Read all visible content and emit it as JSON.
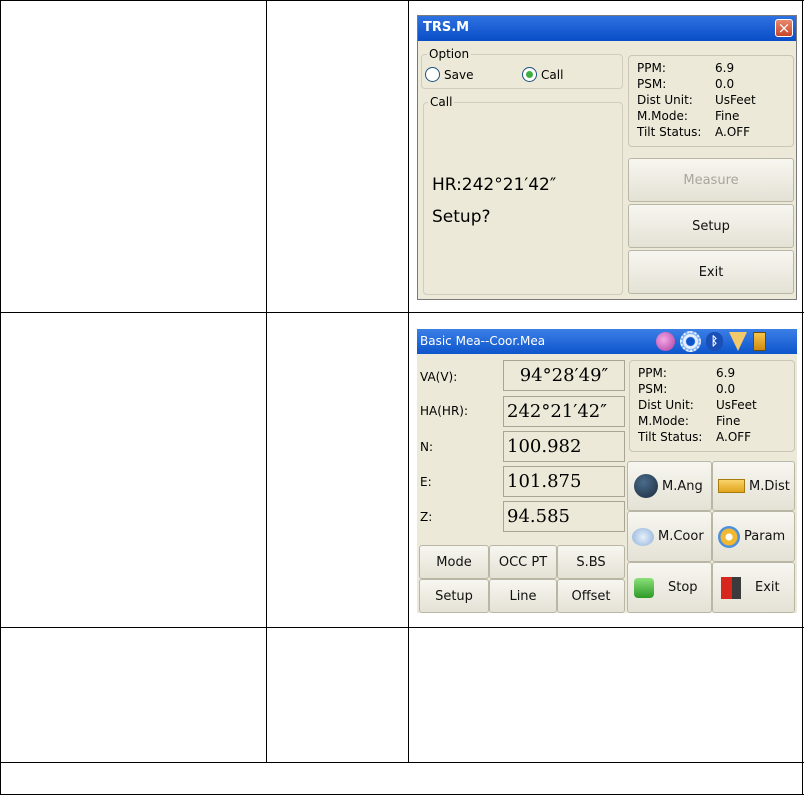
{
  "dialog1": {
    "title": "TRS.M",
    "close_label": "×",
    "option_legend": "Option",
    "save_label": "Save",
    "call_label": "Call",
    "selected_option": "Call",
    "call_legend": "Call",
    "hr_text": "HR:242°21′42″",
    "setup_question": "Setup?",
    "status": [
      {
        "key": "PPM:",
        "value": "6.9"
      },
      {
        "key": "PSM:",
        "value": "0.0"
      },
      {
        "key": "Dist Unit:",
        "value": "UsFeet"
      },
      {
        "key": "M.Mode:",
        "value": "Fine"
      },
      {
        "key": "Tilt Status:",
        "value": "A.OFF"
      }
    ],
    "buttons": {
      "measure": "Measure",
      "setup": "Setup",
      "exit": "Exit"
    }
  },
  "dialog2": {
    "title": "Basic Mea--Coor.Mea",
    "status_icons": [
      "timer-icon",
      "gear-icon",
      "bluetooth-icon",
      "signal-icon",
      "battery-icon"
    ],
    "fields": [
      {
        "label": "VA(V):",
        "value": "94°28′49″"
      },
      {
        "label": "HA(HR):",
        "value": "242°21′42″"
      },
      {
        "label": "N:",
        "value": "100.982"
      },
      {
        "label": "E:",
        "value": "101.875"
      },
      {
        "label": "Z:",
        "value": "94.585"
      }
    ],
    "status": [
      {
        "key": "PPM:",
        "value": "6.9"
      },
      {
        "key": "PSM:",
        "value": "0.0"
      },
      {
        "key": "Dist Unit:",
        "value": "UsFeet"
      },
      {
        "key": "M.Mode:",
        "value": "Fine"
      },
      {
        "key": "Tilt Status:",
        "value": "A.OFF"
      }
    ],
    "small_buttons": [
      "Mode",
      "OCC PT",
      "S.BS",
      "Setup",
      "Line",
      "Offset"
    ],
    "big_buttons": {
      "m_ang": "M.Ang",
      "m_dist": "M.Dist",
      "m_coor": "M.Coor",
      "param": "Param",
      "stop": "Stop",
      "exit": "Exit"
    }
  }
}
